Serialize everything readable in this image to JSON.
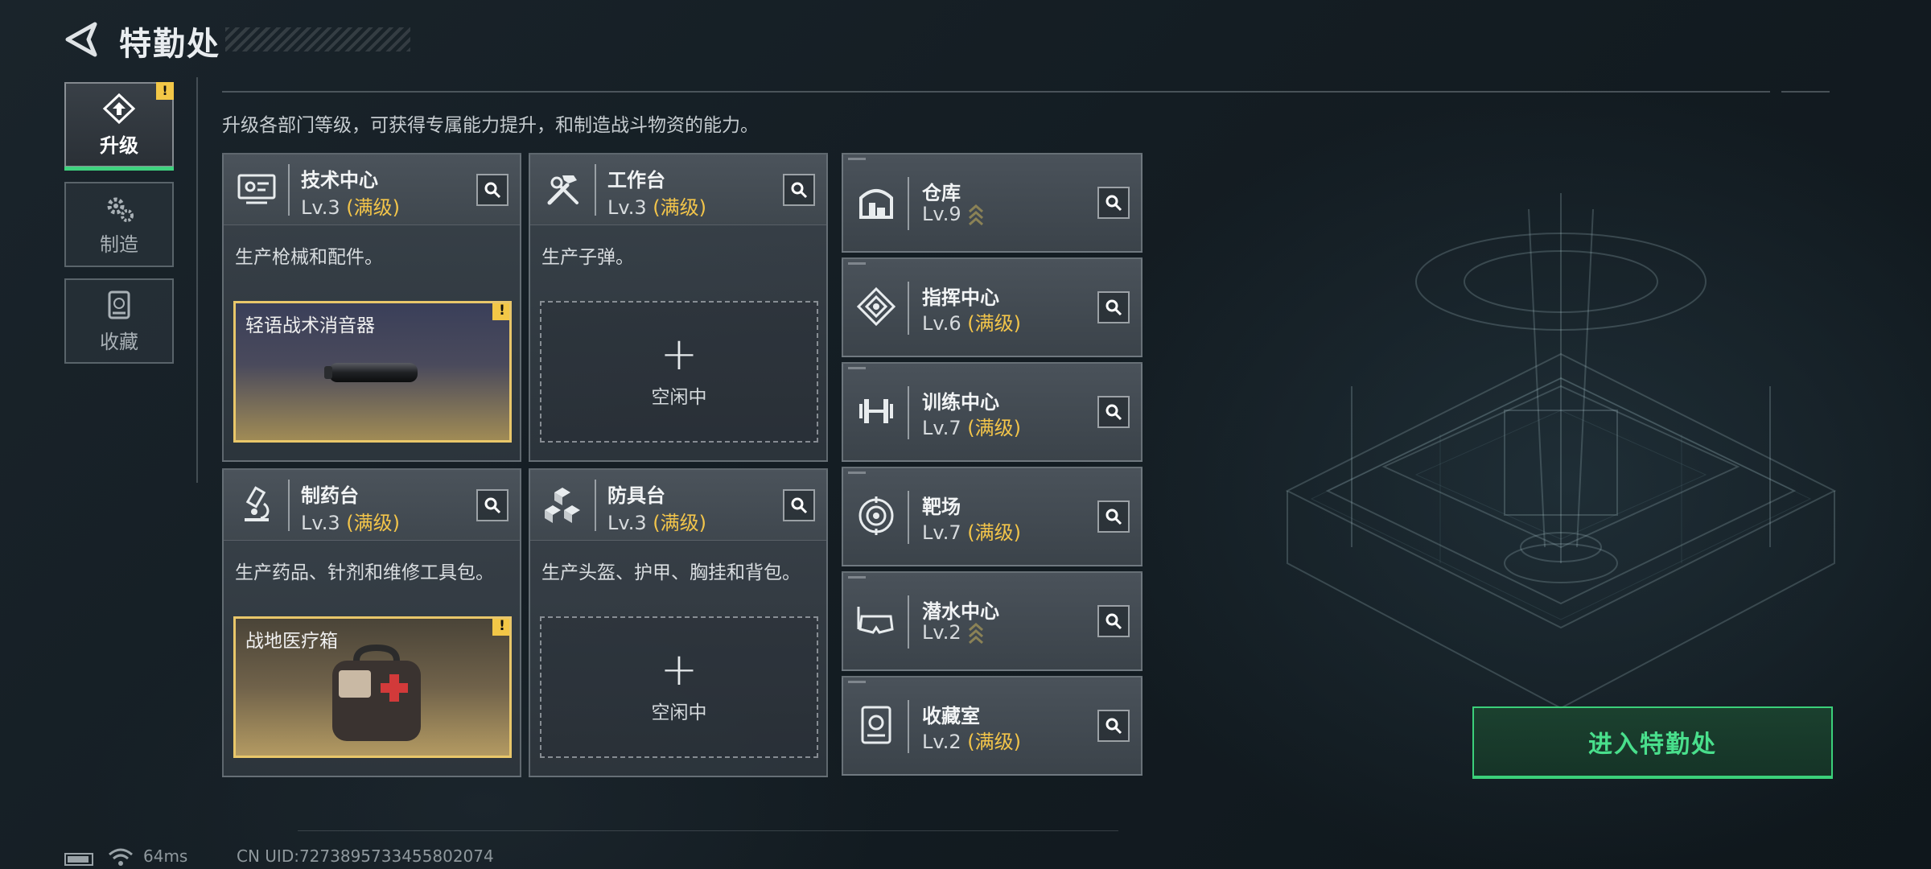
{
  "header": {
    "title": "特勤处"
  },
  "nav": [
    {
      "label": "升级",
      "icon": "upgrade-icon",
      "active": true,
      "alert": "!"
    },
    {
      "label": "制造",
      "icon": "gears-icon",
      "active": false
    },
    {
      "label": "收藏",
      "icon": "collection-icon",
      "active": false
    }
  ],
  "description": "升级各部门等级，可获得专属能力提升，和制造战斗物资的能力。",
  "cards": [
    {
      "name": "技术中心",
      "lv": "Lv.3",
      "max": "(满级)",
      "desc": "生产枪械和配件。",
      "product": "轻语战术消音器",
      "alert": "!"
    },
    {
      "name": "工作台",
      "lv": "Lv.3",
      "max": "(满级)",
      "desc": "生产子弹。",
      "idle": "空闲中"
    },
    {
      "name": "制药台",
      "lv": "Lv.3",
      "max": "(满级)",
      "desc": "生产药品、针剂和维修工具包。",
      "product": "战地医疗箱",
      "alert": "!"
    },
    {
      "name": "防具台",
      "lv": "Lv.3",
      "max": "(满级)",
      "desc": "生产头盔、护甲、胸挂和背包。",
      "idle": "空闲中"
    }
  ],
  "facilities": [
    {
      "name": "仓库",
      "lv": "Lv.9",
      "max": ""
    },
    {
      "name": "指挥中心",
      "lv": "Lv.6",
      "max": "(满级)"
    },
    {
      "name": "训练中心",
      "lv": "Lv.7",
      "max": "(满级)"
    },
    {
      "name": "靶场",
      "lv": "Lv.7",
      "max": "(满级)"
    },
    {
      "name": "潜水中心",
      "lv": "Lv.2",
      "max": ""
    },
    {
      "name": "收藏室",
      "lv": "Lv.2",
      "max": "(满级)"
    }
  ],
  "plus_symbol": "+",
  "enter_button": "进入特勤处",
  "footer": {
    "ping": "64ms",
    "uid": "CN UID:7273895733455802074"
  },
  "colors": {
    "accent": "#3bd07a",
    "max_level": "#f3c54a",
    "alert": "#f3c747"
  }
}
